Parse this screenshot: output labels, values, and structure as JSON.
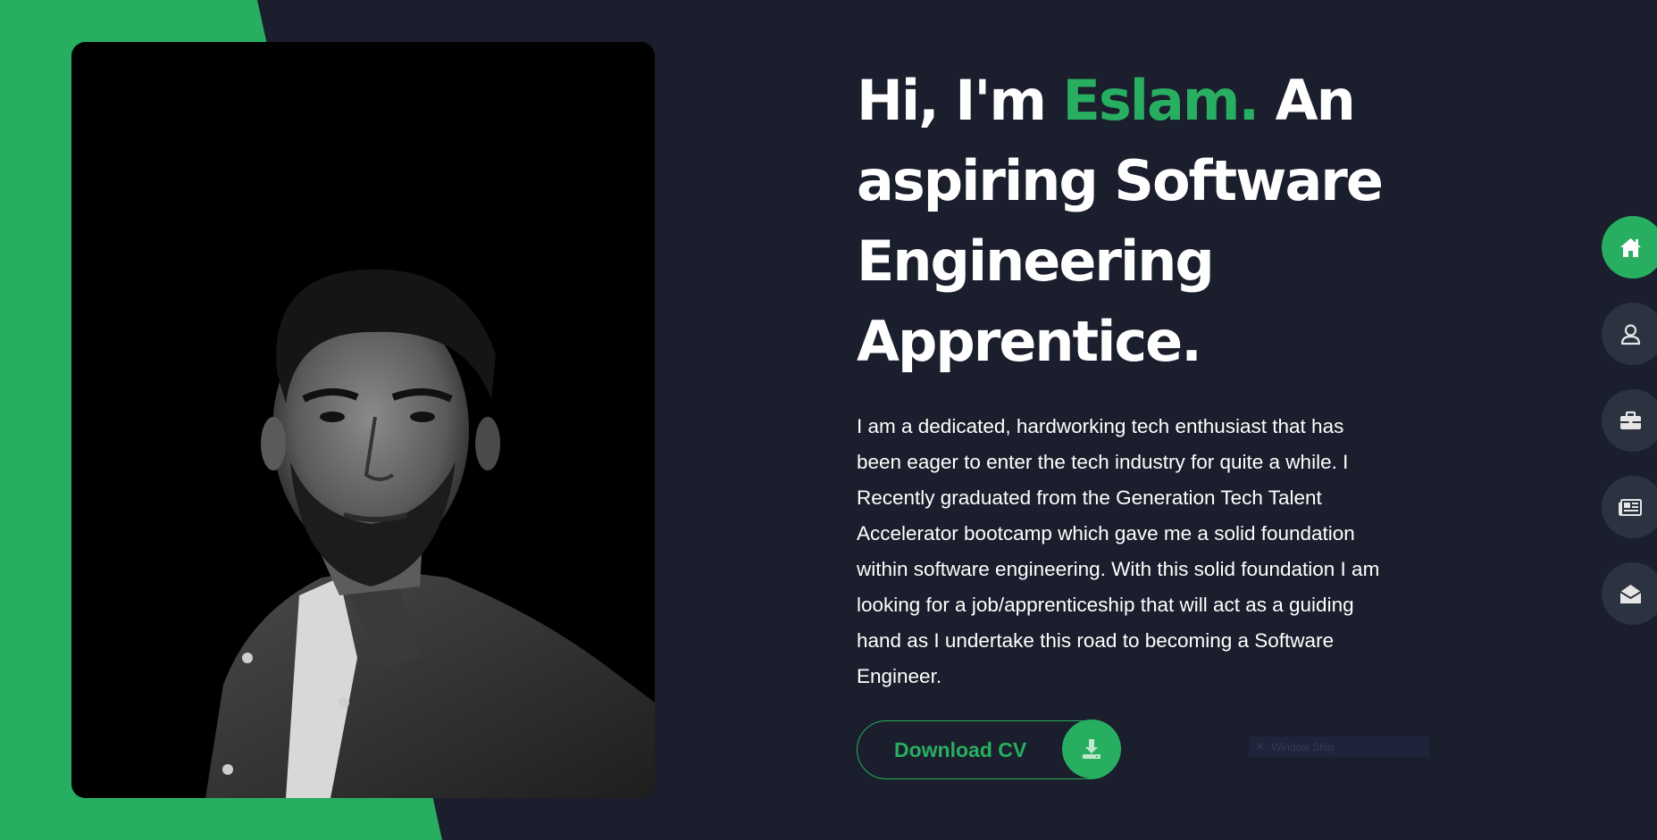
{
  "hero": {
    "greeting": "Hi, I'm ",
    "name": "Eslam.",
    "tagline": " An aspiring Software Engineering Apprentice."
  },
  "bio": "I am a dedicated, hardworking tech enthusiast that has been eager to enter the tech industry for quite a while. I Recently graduated from the Generation Tech Talent Accelerator bootcamp which gave me a solid foundation within software engineering. With this solid foundation I am looking for a job/apprenticeship that will act as a guiding hand as I undertake this road to becoming a Software Engineer.",
  "download_button": {
    "label": "Download CV",
    "icon": "download-icon"
  },
  "widget": {
    "text": "Window Ship"
  },
  "nav": {
    "items": [
      {
        "icon": "home-icon",
        "active": true
      },
      {
        "icon": "user-icon",
        "active": false
      },
      {
        "icon": "briefcase-icon",
        "active": false
      },
      {
        "icon": "newspaper-icon",
        "active": false
      },
      {
        "icon": "envelope-open-icon",
        "active": false
      }
    ]
  },
  "colors": {
    "accent": "#27ae60",
    "background": "#1b1e2c",
    "nav_inactive": "#2b3240",
    "text": "#ffffff"
  }
}
